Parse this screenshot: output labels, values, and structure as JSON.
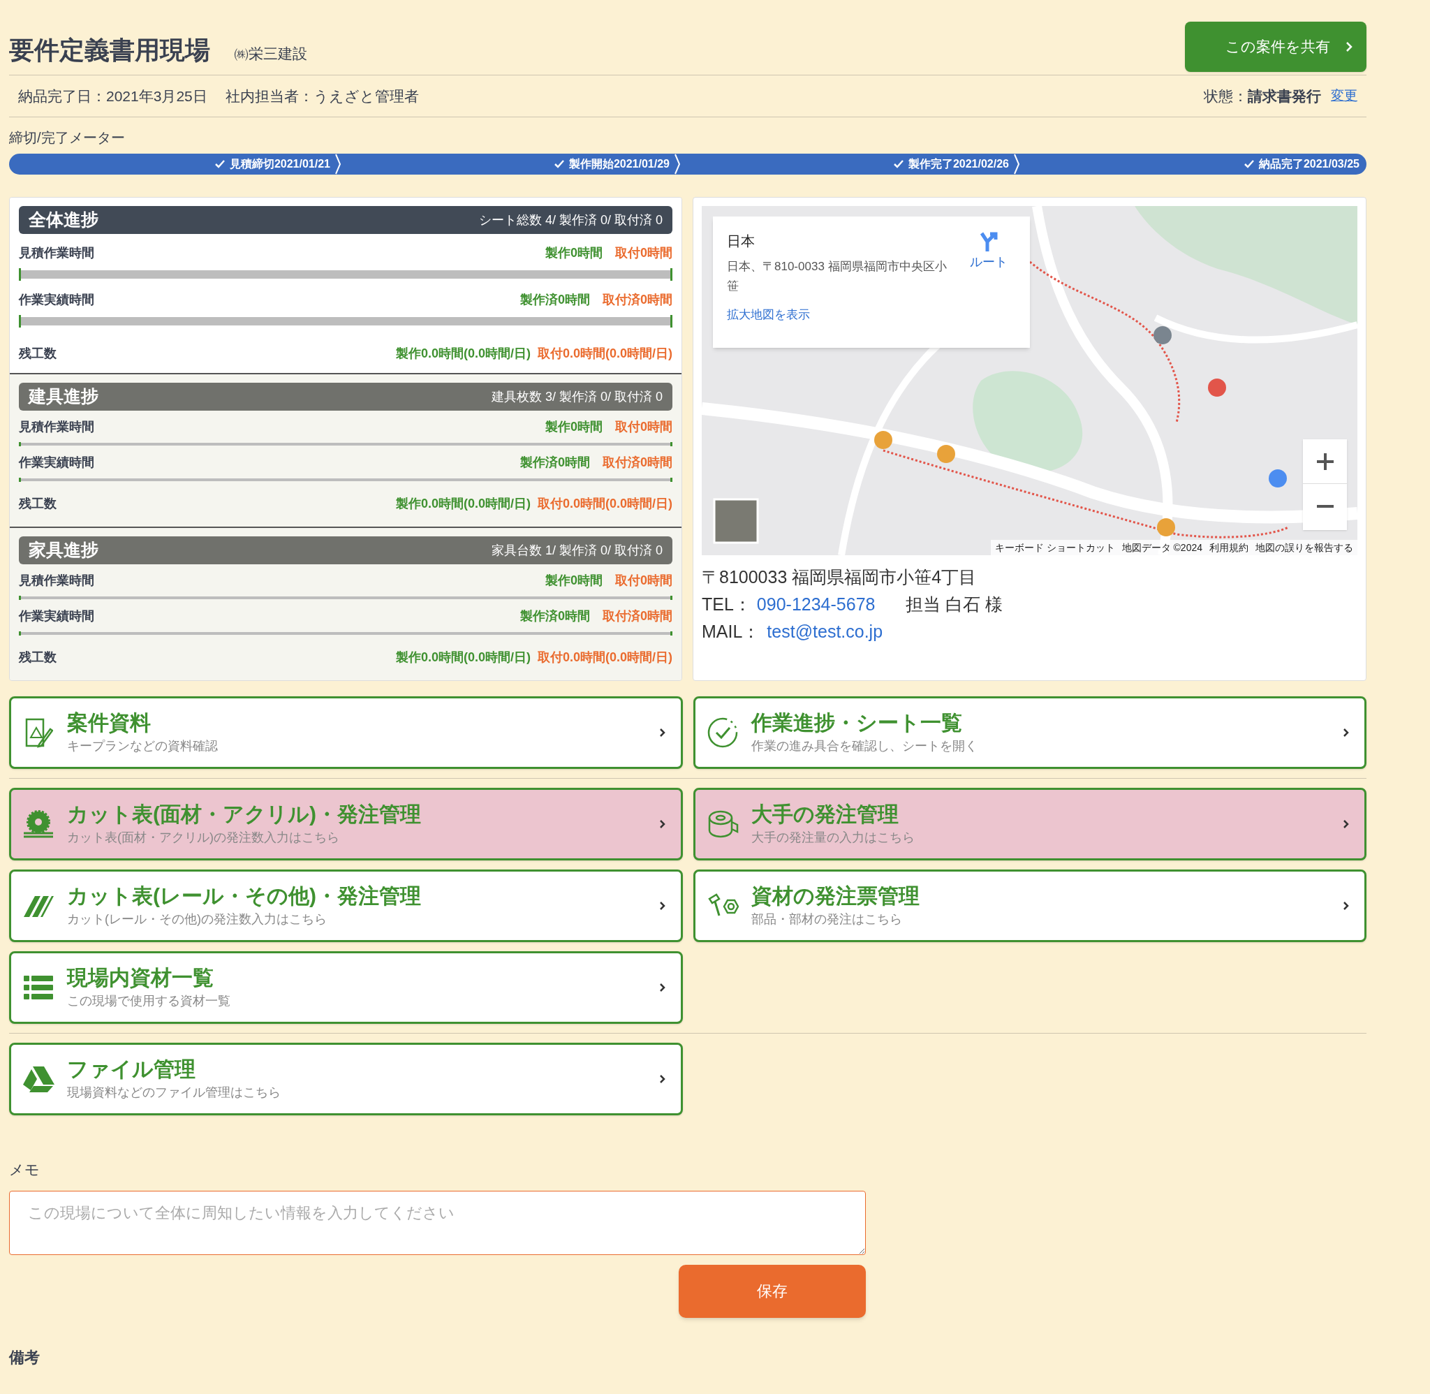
{
  "header": {
    "title": "要件定義書用現場",
    "company": "㈱栄三建設",
    "share_button": "この案件を共有"
  },
  "info": {
    "delivery": "納品完了日：2021年3月25日",
    "staff": "社内担当者：うえざと管理者",
    "status_label": "状態：",
    "status": "請求書発行",
    "change_link": "変更"
  },
  "meter": {
    "label": "締切/完了メーター",
    "steps": [
      {
        "label": "見積締切2021/01/21",
        "done": true
      },
      {
        "label": "製作開始2021/01/29",
        "done": true
      },
      {
        "label": "製作完了2021/02/26",
        "done": true
      },
      {
        "label": "納品完了2021/03/25",
        "done": true
      }
    ]
  },
  "progress": [
    {
      "kind": "total",
      "title": "全体進捗",
      "summary": "シート総数 4/ 製作済 0/ 取付済 0",
      "rows": [
        {
          "kind": "bar",
          "label": "見積作業時間",
          "make": "製作0時間",
          "install": "取付0時間",
          "level": 0
        },
        {
          "kind": "bar",
          "label": "作業実績時間",
          "make": "製作済0時間",
          "install": "取付済0時間",
          "level": 0
        },
        {
          "kind": "plain",
          "label": "残工数",
          "make": "製作0.0時間(0.0時間/日)",
          "install": "取付0.0時間(0.0時間/日)"
        }
      ]
    },
    {
      "kind": "category",
      "title": "建具進捗",
      "summary": "建具枚数 3/ 製作済 0/ 取付済 0",
      "rows": [
        {
          "kind": "bar",
          "label": "見積作業時間",
          "make": "製作0時間",
          "install": "取付0時間",
          "level": 0
        },
        {
          "kind": "bar",
          "label": "作業実績時間",
          "make": "製作済0時間",
          "install": "取付済0時間",
          "level": 0
        },
        {
          "kind": "plain",
          "label": "残工数",
          "make": "製作0.0時間(0.0時間/日)",
          "install": "取付0.0時間(0.0時間/日)"
        }
      ]
    },
    {
      "kind": "category",
      "title": "家具進捗",
      "summary": "家具台数 1/ 製作済 0/ 取付済 0",
      "rows": [
        {
          "kind": "bar",
          "label": "見積作業時間",
          "make": "製作0時間",
          "install": "取付0時間",
          "level": 0
        },
        {
          "kind": "bar",
          "label": "作業実績時間",
          "make": "製作済0時間",
          "install": "取付済0時間",
          "level": 0
        },
        {
          "kind": "plain",
          "label": "残工数",
          "make": "製作0.0時間(0.0時間/日)",
          "install": "取付0.0時間(0.0時間/日)"
        }
      ]
    }
  ],
  "map": {
    "info_title": "日本",
    "info_address": "日本、〒810-0033 福岡県福岡市中央区小笹",
    "route": "ルート",
    "larger_map": "拡大地図を表示",
    "attribution": [
      "キーボード ショートカット",
      "地図データ ©2024",
      "利用規約",
      "地図の誤りを報告する"
    ]
  },
  "contact": {
    "address": "〒8100033 福岡県福岡市小笹4丁目",
    "tel_label": "TEL：",
    "tel": "090-1234-5678",
    "person": "担当 白石 様",
    "mail_label": "MAIL：",
    "mail": "test@test.co.jp"
  },
  "card_groups": [
    {
      "cards": [
        {
          "title": "案件資料",
          "subtitle": "キープランなどの資料確認",
          "tinted": false
        },
        {
          "title": "作業進捗・シート一覧",
          "subtitle": "作業の進み具合を確認し、シートを開く",
          "tinted": false
        }
      ]
    },
    {
      "cards": [
        {
          "title": "カット表(面材・アクリル)・発注管理",
          "subtitle": "カット表(面材・アクリル)の発注数入力はこちら",
          "tinted": true
        },
        {
          "title": "大手の発注管理",
          "subtitle": "大手の発注量の入力はこちら",
          "tinted": true
        },
        {
          "title": "カット表(レール・その他)・発注管理",
          "subtitle": "カット(レール・その他)の発注数入力はこちら",
          "tinted": false
        },
        {
          "title": "資材の発注票管理",
          "subtitle": "部品・部材の発注はこちら",
          "tinted": false
        },
        {
          "title": "現場内資材一覧",
          "subtitle": "この現場で使用する資材一覧",
          "tinted": false
        }
      ]
    },
    {
      "cards": [
        {
          "title": "ファイル管理",
          "subtitle": "現場資料などのファイル管理はこちら",
          "tinted": false
        }
      ]
    }
  ],
  "memo": {
    "label": "メモ",
    "placeholder": "この現場について全体に周知したい情報を入力してください",
    "save_button": "保存"
  },
  "notes_label": "備考"
}
